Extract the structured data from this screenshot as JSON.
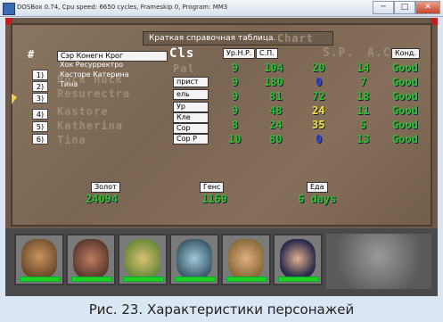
{
  "window": {
    "title": "DOSBox 0.74, Cpu speed:   6650 cycles, Frameskip  0, Program:    MM3",
    "min_label": "─",
    "max_label": "□",
    "close_label": "✕"
  },
  "screen": {
    "title_ru": "Краткая справочная таблица.",
    "title_en": "Chart",
    "hash_label": "#",
    "class_header_en": "Cls",
    "class_header_ru": "Ур.Н.Р.",
    "hp_header_ru": "С.П.",
    "sp_header_en": "S.P.",
    "ac_header_en": "A.C.",
    "cond_header_ru": "Конд.",
    "gold_label_ru": "Золот",
    "gold_value": "24094",
    "gems_label_ru": "Генс",
    "gems_value": "1169",
    "food_label_ru": "Еда",
    "food_value": "6 days"
  },
  "party": [
    {
      "num": "1)",
      "name_ru": "Сэр Конегн Крог",
      "name_en": "Sir Kong Kong",
      "class_en": "Pal",
      "class_ru": "",
      "level": "9",
      "hp": "104",
      "sp": "20",
      "sp_color": "green",
      "ac": "14",
      "cond": "Good"
    },
    {
      "num": "2)",
      "name_ru": "Хок Ресурректро",
      "name_en": "Hock Huck",
      "class_en": "",
      "class_ru": "прист",
      "level": "9",
      "hp": "180",
      "sp": "0",
      "sp_color": "blue",
      "ac": "7",
      "cond": "Good"
    },
    {
      "num": "3)",
      "name_ru": "Касторе Катерина",
      "name_en": "Resurectra",
      "class_en": "",
      "class_ru": "ель",
      "level": "9",
      "hp": "81",
      "sp": "72",
      "sp_color": "green",
      "ac": "18",
      "cond": "Good"
    },
    {
      "num": "4)",
      "name_ru": "Тина",
      "name_en": "Kastore",
      "class_en": "",
      "class_ru": "Ур",
      "level": "9",
      "hp": "48",
      "sp": "24",
      "sp_color": "yellow",
      "ac": "11",
      "cond": "Good"
    },
    {
      "num": "5)",
      "name_ru": "",
      "name_en": "Katherina",
      "class_en": "",
      "class_ru": "Кле",
      "level": "8",
      "hp": "24",
      "sp": "35",
      "sp_color": "yellow",
      "ac": "5",
      "cond": "Good"
    },
    {
      "num": "6)",
      "name_ru": "",
      "name_en": "Tina",
      "class_en": "",
      "class_ru": "Сор",
      "level": "10",
      "hp": "80",
      "sp": "0",
      "sp_color": "blue",
      "ac": "13",
      "cond": "Good"
    }
  ],
  "extra_class_ru": "Сор Р",
  "caption": "Рис. 23. Характеристики персонажей"
}
